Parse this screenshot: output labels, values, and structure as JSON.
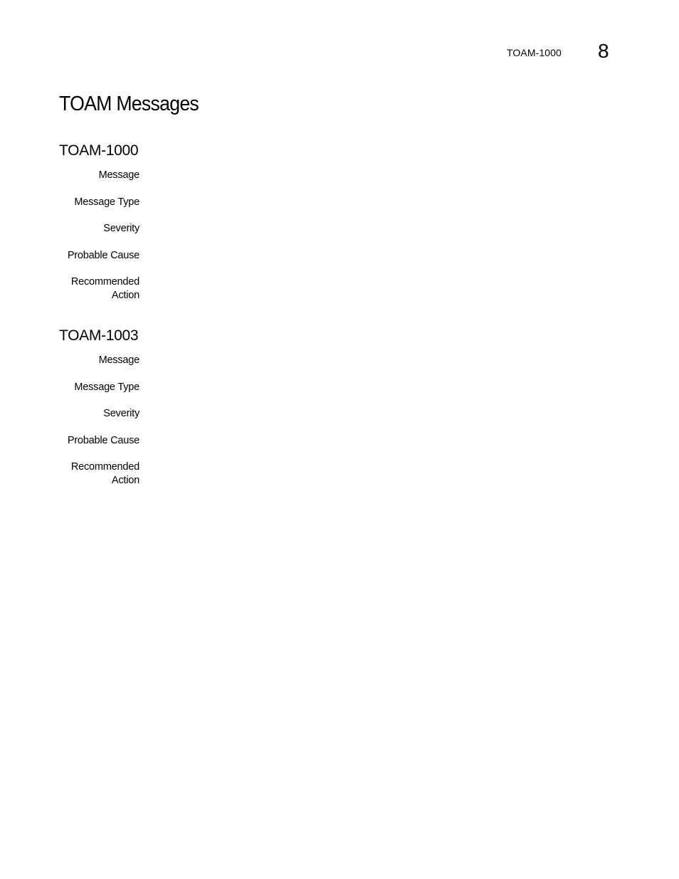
{
  "running_header": {
    "title": "TOAM-1000",
    "chapter_number": "8"
  },
  "page_title": "TOAM Messages",
  "sections": [
    {
      "id": "TOAM-1000",
      "fields": [
        {
          "label": "Message",
          "value": ""
        },
        {
          "label": "Message Type",
          "value": ""
        },
        {
          "label": "Severity",
          "value": ""
        },
        {
          "label": "Probable Cause",
          "value": ""
        },
        {
          "label_line1": "Recommended",
          "label_line2": "Action",
          "value": ""
        }
      ]
    },
    {
      "id": "TOAM-1003",
      "fields": [
        {
          "label": "Message",
          "value": ""
        },
        {
          "label": "Message Type",
          "value": ""
        },
        {
          "label": "Severity",
          "value": ""
        },
        {
          "label": "Probable Cause",
          "value": ""
        },
        {
          "label_line1": "Recommended",
          "label_line2": "Action",
          "value": ""
        }
      ]
    }
  ]
}
